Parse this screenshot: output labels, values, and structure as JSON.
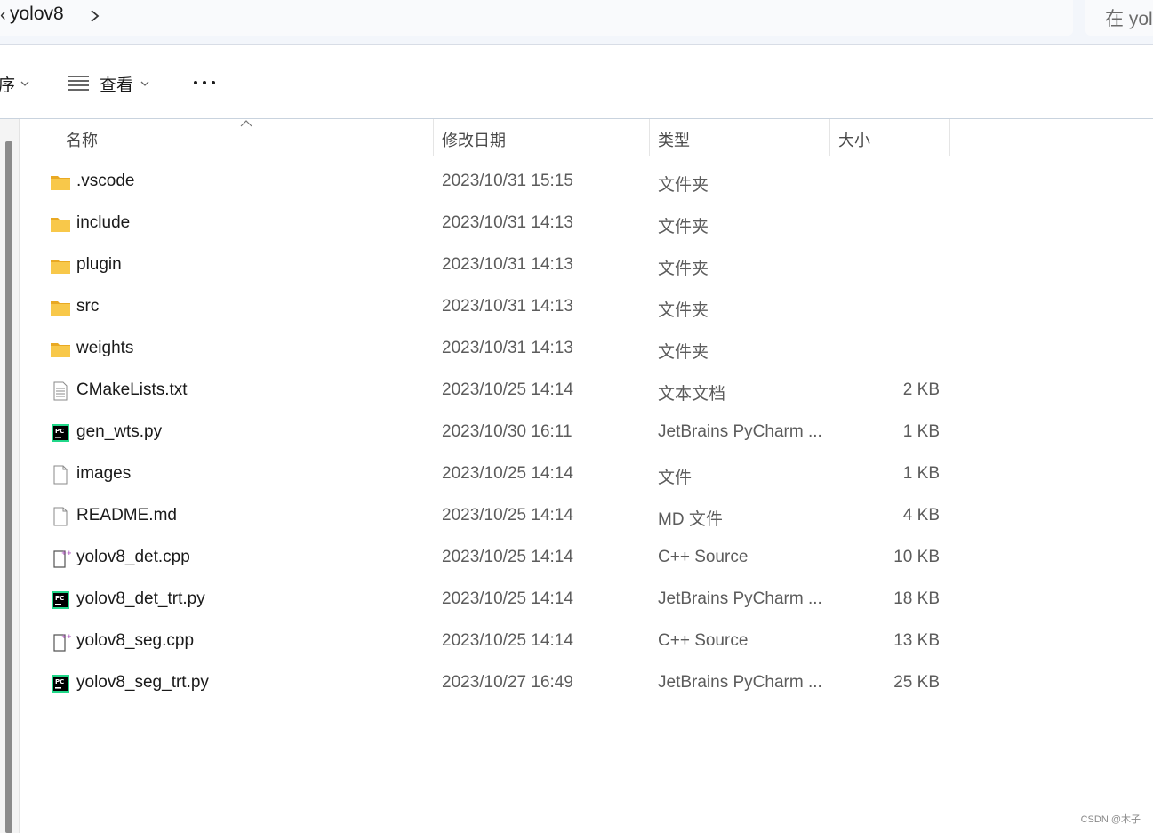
{
  "address_bar": {
    "lead_glyph": "‹",
    "breadcrumb": "yolov8",
    "search_placeholder": "在 yol"
  },
  "command_bar": {
    "partial_label": "序",
    "view_label": "查看"
  },
  "columns": {
    "name": "名称",
    "date": "修改日期",
    "type": "类型",
    "size": "大小"
  },
  "files": [
    {
      "name": ".vscode",
      "date": "2023/10/31 15:15",
      "type": "文件夹",
      "size": "",
      "icon": "folder-icon"
    },
    {
      "name": "include",
      "date": "2023/10/31 14:13",
      "type": "文件夹",
      "size": "",
      "icon": "folder-icon"
    },
    {
      "name": "plugin",
      "date": "2023/10/31 14:13",
      "type": "文件夹",
      "size": "",
      "icon": "folder-icon"
    },
    {
      "name": "src",
      "date": "2023/10/31 14:13",
      "type": "文件夹",
      "size": "",
      "icon": "folder-icon"
    },
    {
      "name": "weights",
      "date": "2023/10/31 14:13",
      "type": "文件夹",
      "size": "",
      "icon": "folder-icon"
    },
    {
      "name": "CMakeLists.txt",
      "date": "2023/10/25 14:14",
      "type": "文本文档",
      "size": "2 KB",
      "icon": "text-file-icon"
    },
    {
      "name": "gen_wts.py",
      "date": "2023/10/30 16:11",
      "type": "JetBrains PyCharm ...",
      "size": "1 KB",
      "icon": "pycharm-file-icon"
    },
    {
      "name": "images",
      "date": "2023/10/25 14:14",
      "type": "文件",
      "size": "1 KB",
      "icon": "blank-file-icon"
    },
    {
      "name": "README.md",
      "date": "2023/10/25 14:14",
      "type": "MD 文件",
      "size": "4 KB",
      "icon": "blank-file-icon"
    },
    {
      "name": "yolov8_det.cpp",
      "date": "2023/10/25 14:14",
      "type": "C++ Source",
      "size": "10 KB",
      "icon": "cpp-file-icon"
    },
    {
      "name": "yolov8_det_trt.py",
      "date": "2023/10/25 14:14",
      "type": "JetBrains PyCharm ...",
      "size": "18 KB",
      "icon": "pycharm-file-icon"
    },
    {
      "name": "yolov8_seg.cpp",
      "date": "2023/10/25 14:14",
      "type": "C++ Source",
      "size": "13 KB",
      "icon": "cpp-file-icon"
    },
    {
      "name": "yolov8_seg_trt.py",
      "date": "2023/10/27 16:49",
      "type": "JetBrains PyCharm ...",
      "size": "25 KB",
      "icon": "pycharm-file-icon"
    }
  ],
  "watermark": "CSDN @木子",
  "colors": {
    "folder": "#f8c84a",
    "folder_dark": "#e9a923",
    "pycharm_green": "#21d789",
    "cpp_accent": "#b05ac0",
    "address_bg": "#f3f6fb"
  }
}
